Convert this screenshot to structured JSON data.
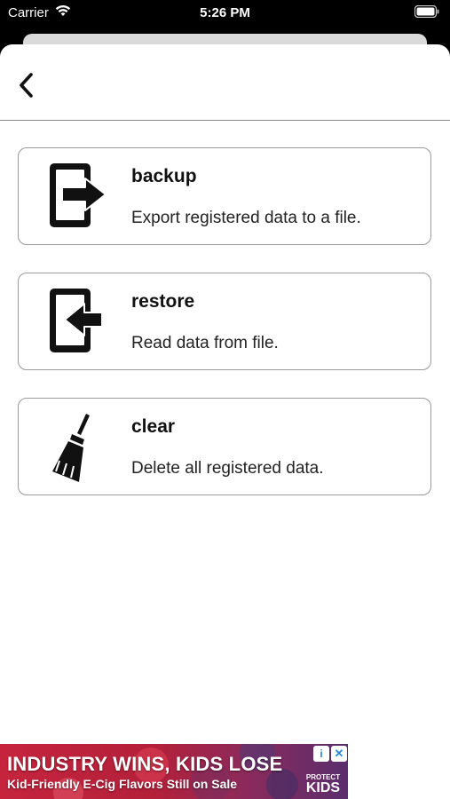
{
  "status_bar": {
    "carrier": "Carrier",
    "time": "5:26 PM",
    "wifi_icon": "wifi-icon",
    "battery_icon": "battery-icon"
  },
  "nav": {
    "back_icon": "chevron-left-icon"
  },
  "menu": [
    {
      "icon": "export-icon",
      "title": "backup",
      "description": "Export registered data to a file."
    },
    {
      "icon": "import-icon",
      "title": "restore",
      "description": "Read data from file."
    },
    {
      "icon": "broom-icon",
      "title": "clear",
      "description": "Delete all registered data."
    }
  ],
  "ad": {
    "headline": "INDUSTRY WINS, KIDS LOSE",
    "subline": "Kid-Friendly E-Cig Flavors Still on Sale",
    "logo_top": "PROTECT",
    "logo_bottom": "KIDS",
    "info_label": "i",
    "close_label": "✕",
    "colors": {
      "primary": "#c6243d",
      "secondary": "#5a2e6e",
      "control": "#2a8ad8"
    }
  }
}
